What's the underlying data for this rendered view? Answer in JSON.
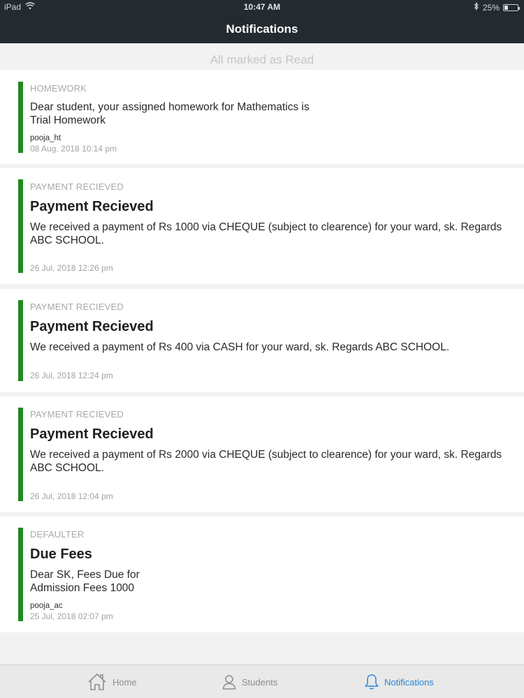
{
  "status_bar": {
    "device": "iPad",
    "time": "10:47 AM",
    "battery": "25%",
    "battery_level": 0.25
  },
  "header": {
    "title": "Notifications"
  },
  "marked_text": "All marked as Read",
  "notifications": [
    {
      "category": "HOMEWORK",
      "title": "",
      "body_lines": [
        "Dear student, your assigned homework for Mathematics is",
        "Trial Homework"
      ],
      "user": "pooja_ht",
      "date": "08 Aug, 2018 10:14 pm"
    },
    {
      "category": "PAYMENT RECIEVED",
      "title": "Payment Recieved",
      "body_lines": [
        "We received a payment of Rs 1000 via CHEQUE (subject to clearence) for your ward, sk. Regards",
        "ABC SCHOOL."
      ],
      "user": "",
      "date": "26 Jul, 2018 12:26 pm"
    },
    {
      "category": "PAYMENT RECIEVED",
      "title": "Payment Recieved",
      "body_lines": [
        "We received a payment of Rs 400 via CASH for your ward, sk. Regards ABC SCHOOL."
      ],
      "user": "",
      "date": "26 Jul, 2018 12:24 pm"
    },
    {
      "category": "PAYMENT RECIEVED",
      "title": "Payment Recieved",
      "body_lines": [
        "We received a payment of Rs 2000 via CHEQUE (subject to clearence) for your ward, sk. Regards",
        "ABC SCHOOL."
      ],
      "user": "",
      "date": "26 Jul, 2018 12:04 pm"
    },
    {
      "category": "DEFAULTER",
      "title": "Due Fees",
      "body_lines": [
        "Dear SK, Fees Due for",
        "Admission Fees 1000"
      ],
      "user": "pooja_ac",
      "date": "25 Jul, 2018 02:07 pm"
    }
  ],
  "tabs": [
    {
      "label": "Home",
      "icon": "home-icon",
      "active": false
    },
    {
      "label": "Students",
      "icon": "person-icon",
      "active": false
    },
    {
      "label": "Notifications",
      "icon": "bell-icon",
      "active": true
    }
  ],
  "colors": {
    "nav_background": "#232a30",
    "accent_bar": "#1f8a1f",
    "active_tab": "#2a84d8"
  }
}
